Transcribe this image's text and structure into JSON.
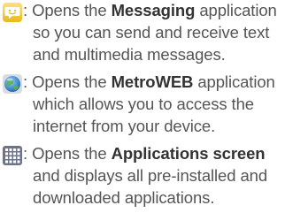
{
  "entries": [
    {
      "icon": "messaging-icon",
      "line1_pre": ": Opens the ",
      "line1_bold": "Messaging",
      "line1_post": " application",
      "line2": "so you can send and receive text",
      "line3": "and multimedia messages."
    },
    {
      "icon": "metroweb-icon",
      "line1_pre": ": Opens the ",
      "line1_bold": "MetroWEB",
      "line1_post": " application",
      "line2": "which allows you to access the",
      "line3": "internet from your device."
    },
    {
      "icon": "applications-grid-icon",
      "line1_pre": ": Opens the ",
      "line1_bold": "Applications screen",
      "line1_post": "",
      "line2": "and displays all pre-installed and",
      "line3": "downloaded applications."
    }
  ],
  "colors": {
    "text": "#555555",
    "bold_text": "#333333",
    "messaging_icon_body": "#f5d23c",
    "metroweb_icon_body": "#2e7fc8",
    "applications_icon_body": "#6e7488"
  }
}
